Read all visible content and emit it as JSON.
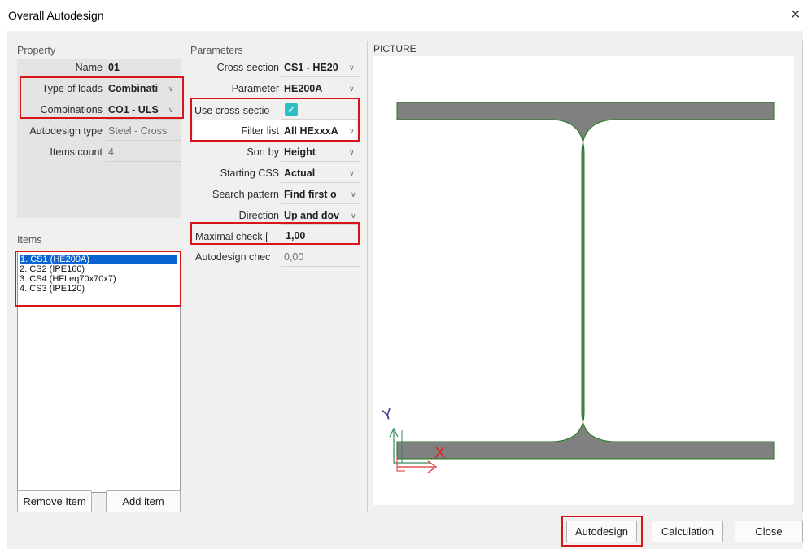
{
  "window": {
    "title": "Overall Autodesign",
    "close_glyph": "×"
  },
  "property": {
    "header": "Property",
    "name_label": "Name",
    "name_value": "01",
    "type_of_loads_label": "Type of loads",
    "type_of_loads_value": "Combinati",
    "combinations_label": "Combinations",
    "combinations_value": "CO1 - ULS",
    "autodesign_type_label": "Autodesign type",
    "autodesign_type_value": "Steel - Cross",
    "items_count_label": "Items count",
    "items_count_value": "4"
  },
  "items": {
    "header": "Items",
    "list": [
      "1. CS1 (HE200A)",
      "2. CS2 (IPE160)",
      "3. CS4 (HFLeq70x70x7)",
      "4. CS3 (IPE120)"
    ],
    "remove_label": "Remove Item",
    "add_label": "Add item"
  },
  "parameters": {
    "header": "Parameters",
    "cross_section_label": "Cross-section",
    "cross_section_value": "CS1 - HE20",
    "parameter_label": "Parameter",
    "parameter_value": "HE200A",
    "use_cs_label": "Use cross-sectio",
    "use_cs_checked": true,
    "filter_list_label": "Filter list",
    "filter_list_value": "All HExxxA",
    "sort_by_label": "Sort by",
    "sort_by_value": "Height",
    "starting_css_label": "Starting CSS",
    "starting_css_value": "Actual",
    "search_pattern_label": "Search pattern",
    "search_pattern_value": "Find first o",
    "direction_label": "Direction",
    "direction_value": "Up and dov",
    "maximal_check_label": "Maximal check [",
    "maximal_check_value": "1,00",
    "autodesign_check_label": "Autodesign chec",
    "autodesign_check_value": "0,00"
  },
  "picture": {
    "header": "PICTURE",
    "axis_y": "Y",
    "axis_x": "X",
    "section_fill": "#808080",
    "section_stroke": "#1f7a1f"
  },
  "footer": {
    "autodesign_label": "Autodesign",
    "calculation_label": "Calculation",
    "close_label": "Close"
  },
  "colors": {
    "highlight": "#d8141a",
    "selection": "#0a64d2",
    "checkbox": "#2dbfc6"
  }
}
